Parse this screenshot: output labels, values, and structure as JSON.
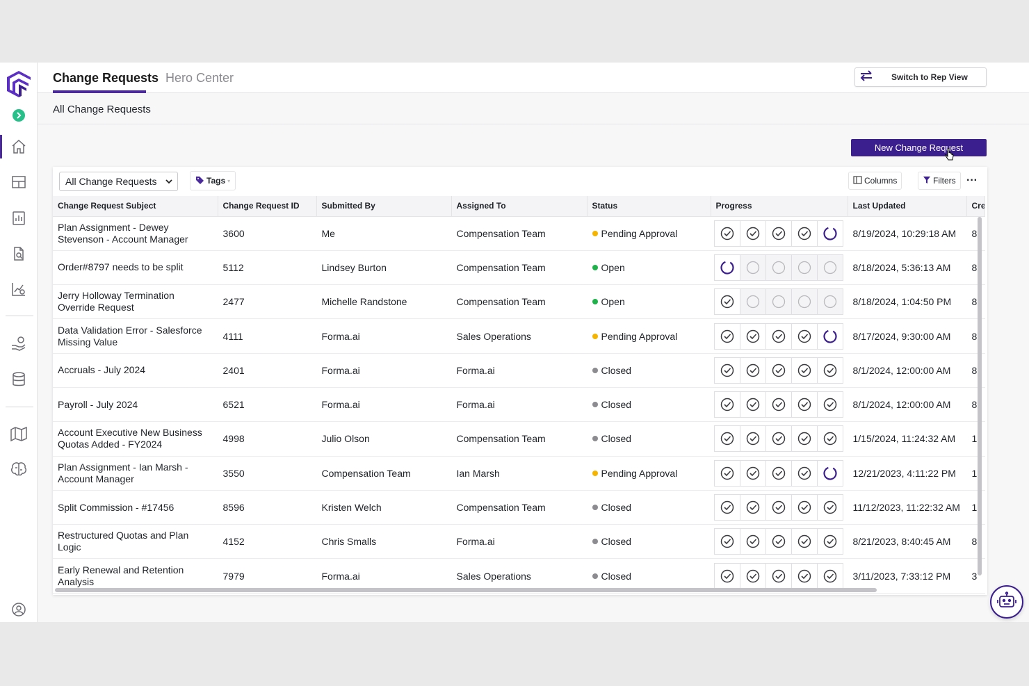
{
  "header": {
    "tabs": [
      {
        "label": "Change Requests",
        "active": true
      },
      {
        "label": "Hero Center",
        "active": false
      }
    ],
    "switch_button": {
      "label": "Switch to Rep View",
      "icon": "swap-arrows-icon"
    }
  },
  "subheader": {
    "title": "All Change Requests"
  },
  "sidebar": {
    "items": [
      {
        "name": "home",
        "icon": "home-icon",
        "active": true
      },
      {
        "name": "dashboard",
        "icon": "layout-icon"
      },
      {
        "name": "reports",
        "icon": "report-chart-icon"
      },
      {
        "name": "document-search",
        "icon": "document-search-icon"
      },
      {
        "name": "analytics",
        "icon": "chart-dollar-icon"
      },
      {
        "name": "payouts",
        "icon": "hand-coin-icon"
      },
      {
        "name": "data",
        "icon": "database-icon"
      },
      {
        "name": "territory",
        "icon": "map-icon"
      },
      {
        "name": "ai",
        "icon": "brain-icon"
      },
      {
        "name": "profile",
        "icon": "user-circle-icon"
      }
    ]
  },
  "actions": {
    "new_request": "New Change Request"
  },
  "toolbar": {
    "view_select": "All Change Requests",
    "tags": "Tags",
    "columns": "Columns",
    "filters": "Filters",
    "more": "···"
  },
  "table": {
    "columns": [
      "Change Request Subject",
      "Change Request ID",
      "Submitted By",
      "Assigned To",
      "Status",
      "Progress",
      "Last Updated",
      "Cre"
    ],
    "rows": [
      {
        "subject": "Plan Assignment - Dewey Stevenson - Account Manager",
        "id": "3600",
        "submitted_by": "Me",
        "assigned_to": "Compensation Team",
        "status": "Pending Approval",
        "progress": [
          "done",
          "done",
          "done",
          "done",
          "active"
        ],
        "updated": "8/19/2024, 10:29:18 AM",
        "created": "8"
      },
      {
        "subject": "Order#8797 needs to be split",
        "id": "5112",
        "submitted_by": "Lindsey Burton",
        "assigned_to": "Compensation Team",
        "status": "Open",
        "progress": [
          "active",
          "todo",
          "todo",
          "todo",
          "todo"
        ],
        "updated": "8/18/2024, 5:36:13 AM",
        "created": "8"
      },
      {
        "subject": "Jerry Holloway Termination Override Request",
        "id": "2477",
        "submitted_by": "Michelle Randstone",
        "assigned_to": "Compensation Team",
        "status": "Open",
        "progress": [
          "done",
          "todo",
          "todo",
          "todo",
          "todo"
        ],
        "updated": "8/18/2024, 1:04:50 PM",
        "created": "8"
      },
      {
        "subject": "Data Validation Error - Salesforce Missing Value",
        "id": "4111",
        "submitted_by": "Forma.ai",
        "assigned_to": "Sales Operations",
        "status": "Pending Approval",
        "progress": [
          "done",
          "done",
          "done",
          "done",
          "active"
        ],
        "updated": "8/17/2024, 9:30:00 AM",
        "created": "8"
      },
      {
        "subject": "Accruals - July 2024",
        "id": "2401",
        "submitted_by": "Forma.ai",
        "assigned_to": "Forma.ai",
        "status": "Closed",
        "progress": [
          "done",
          "done",
          "done",
          "done",
          "done"
        ],
        "updated": "8/1/2024, 12:00:00 AM",
        "created": "8"
      },
      {
        "subject": "Payroll - July 2024",
        "id": "6521",
        "submitted_by": "Forma.ai",
        "assigned_to": "Forma.ai",
        "status": "Closed",
        "progress": [
          "done",
          "done",
          "done",
          "done",
          "done"
        ],
        "updated": "8/1/2024, 12:00:00 AM",
        "created": "8"
      },
      {
        "subject": "Account Executive New Business Quotas Added - FY2024",
        "id": "4998",
        "submitted_by": "Julio Olson",
        "assigned_to": "Compensation Team",
        "status": "Closed",
        "progress": [
          "done",
          "done",
          "done",
          "done",
          "done"
        ],
        "updated": "1/15/2024, 11:24:32 AM",
        "created": "1"
      },
      {
        "subject": "Plan Assignment - Ian Marsh - Account Manager",
        "id": "3550",
        "submitted_by": "Compensation Team",
        "assigned_to": "Ian Marsh",
        "status": "Pending Approval",
        "progress": [
          "done",
          "done",
          "done",
          "done",
          "active"
        ],
        "updated": "12/21/2023, 4:11:22 PM",
        "created": "1"
      },
      {
        "subject": "Split Commission - #17456",
        "id": "8596",
        "submitted_by": "Kristen Welch",
        "assigned_to": "Compensation Team",
        "status": "Closed",
        "progress": [
          "done",
          "done",
          "done",
          "done",
          "done"
        ],
        "updated": "11/12/2023, 11:22:32 AM",
        "created": "1"
      },
      {
        "subject": "Restructured Quotas and Plan Logic",
        "id": "4152",
        "submitted_by": "Chris Smalls",
        "assigned_to": "Forma.ai",
        "status": "Closed",
        "progress": [
          "done",
          "done",
          "done",
          "done",
          "done"
        ],
        "updated": "8/21/2023, 8:40:45 AM",
        "created": "8"
      },
      {
        "subject": "Early Renewal and Retention Analysis",
        "id": "7979",
        "submitted_by": "Forma.ai",
        "assigned_to": "Sales Operations",
        "status": "Closed",
        "progress": [
          "done",
          "done",
          "done",
          "done",
          "done"
        ],
        "updated": "3/11/2023, 7:33:12 PM",
        "created": "3"
      }
    ]
  },
  "status_colors": {
    "Pending Approval": "#f5b400",
    "Open": "#1fb24a",
    "Closed": "#8c8c90"
  },
  "colors": {
    "brand": "#3c1f8f",
    "accent_green": "#27c08a"
  },
  "assistant": {
    "icon": "robot-icon"
  }
}
